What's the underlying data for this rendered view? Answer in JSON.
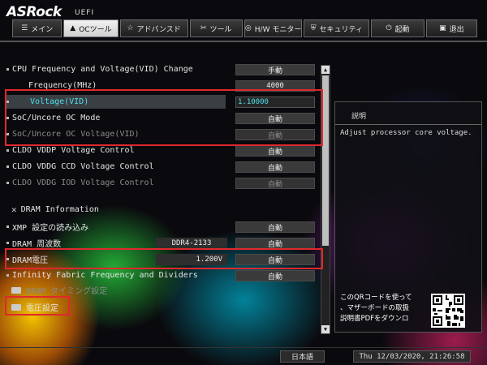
{
  "header": {
    "brand": "ASRock",
    "subtitle": "UEFI",
    "tabs": [
      {
        "icon": "☰",
        "label": "メイン"
      },
      {
        "icon": "▲",
        "label": "OCツール"
      },
      {
        "icon": "☆",
        "label": "アドバンスド"
      },
      {
        "icon": "✂",
        "label": "ツール"
      },
      {
        "icon": "◎",
        "label": "H/W モニター"
      },
      {
        "icon": "⛨",
        "label": "セキュリティ"
      },
      {
        "icon": "⏻",
        "label": "起動"
      },
      {
        "icon": "▣",
        "label": "退出"
      }
    ]
  },
  "settings": {
    "cpu_freq_voltage": {
      "label": "CPU Frequency and Voltage(VID) Change",
      "value": "手動"
    },
    "frequency": {
      "label": "Frequency(MHz)",
      "value": "4000"
    },
    "voltage_vid": {
      "label": "Voltage(VID)",
      "value": "1.10000"
    },
    "soc_uncore_mode": {
      "label": "SoC/Uncore OC Mode",
      "value": "自動"
    },
    "soc_uncore_voltage": {
      "label": "SoC/Uncore OC Voltage(VID)",
      "value": "自動"
    },
    "cldo_vddp": {
      "label": "CLDO VDDP Voltage Control",
      "value": "自動"
    },
    "cldo_vddg_ccd": {
      "label": "CLDO VDDG CCD Voltage Control",
      "value": "自動"
    },
    "cldo_vddg_iod": {
      "label": "CLDO VDDG IOD Voltage Control",
      "value": "自動"
    },
    "dram_info": {
      "label": "DRAM Information"
    },
    "xmp_load": {
      "label": "XMP 設定の読み込み",
      "value": "自動"
    },
    "dram_freq": {
      "label": "DRAM 周波数",
      "info": "DDR4-2133",
      "value": "自動"
    },
    "dram_voltage": {
      "label": "DRAM電圧",
      "info": "1.200V",
      "value": "自動"
    },
    "infinity_fabric": {
      "label": "Infinity Fabric Frequency and Dividers",
      "value": "自動"
    },
    "dram_timing": {
      "label": "DRAM タイミング設定"
    },
    "voltage_config": {
      "label": "電圧設定"
    }
  },
  "description": {
    "title": "説明",
    "text": "Adjust processor core voltage.",
    "qr_line1": "このQRコードを使って",
    "qr_line2": "、マザーボードの取扱",
    "qr_line3": "説明書PDFをダウンロ"
  },
  "footer": {
    "language": "日本語",
    "datetime": "Thu 12/03/2020, 21:26:58"
  }
}
